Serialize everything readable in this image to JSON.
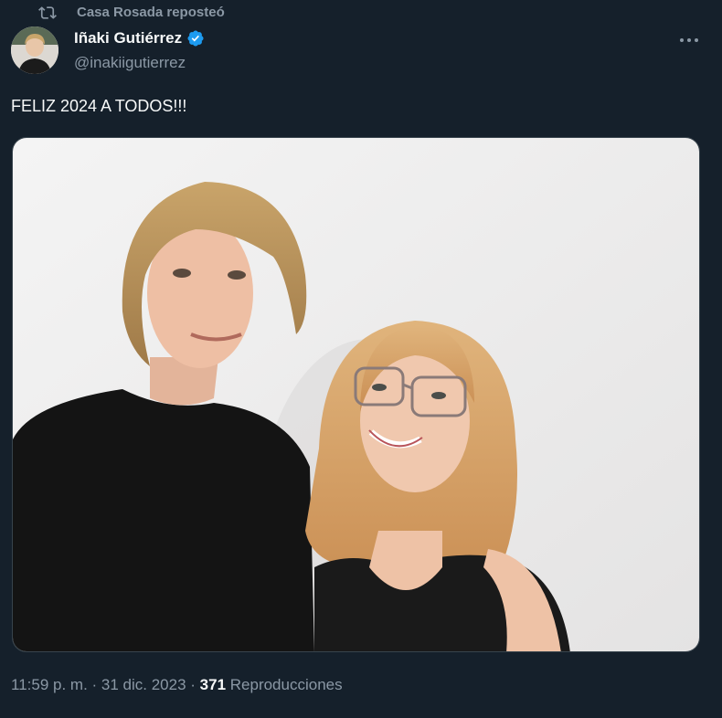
{
  "repost": {
    "icon": "repost-icon",
    "text": "Casa Rosada reposteó"
  },
  "author": {
    "display_name": "Iñaki Gutiérrez",
    "handle": "@inakiigutierrez",
    "verified_icon": "verified-badge-icon",
    "avatar_icon": "avatar"
  },
  "more_icon": "more-options-icon",
  "tweet": {
    "text": "FELIZ 2024 A TODOS!!!"
  },
  "media": {
    "icon": "photo"
  },
  "meta": {
    "time": "11:59 p. m.",
    "separator1": " · ",
    "date": "31 dic. 2023",
    "separator2": " · ",
    "views_count": "371",
    "views_label": " Reproducciones"
  },
  "colors": {
    "background": "#15202b",
    "secondary_text": "#8b98a5",
    "primary_text": "#f7f9f9",
    "verified": "#1d9bf0"
  }
}
